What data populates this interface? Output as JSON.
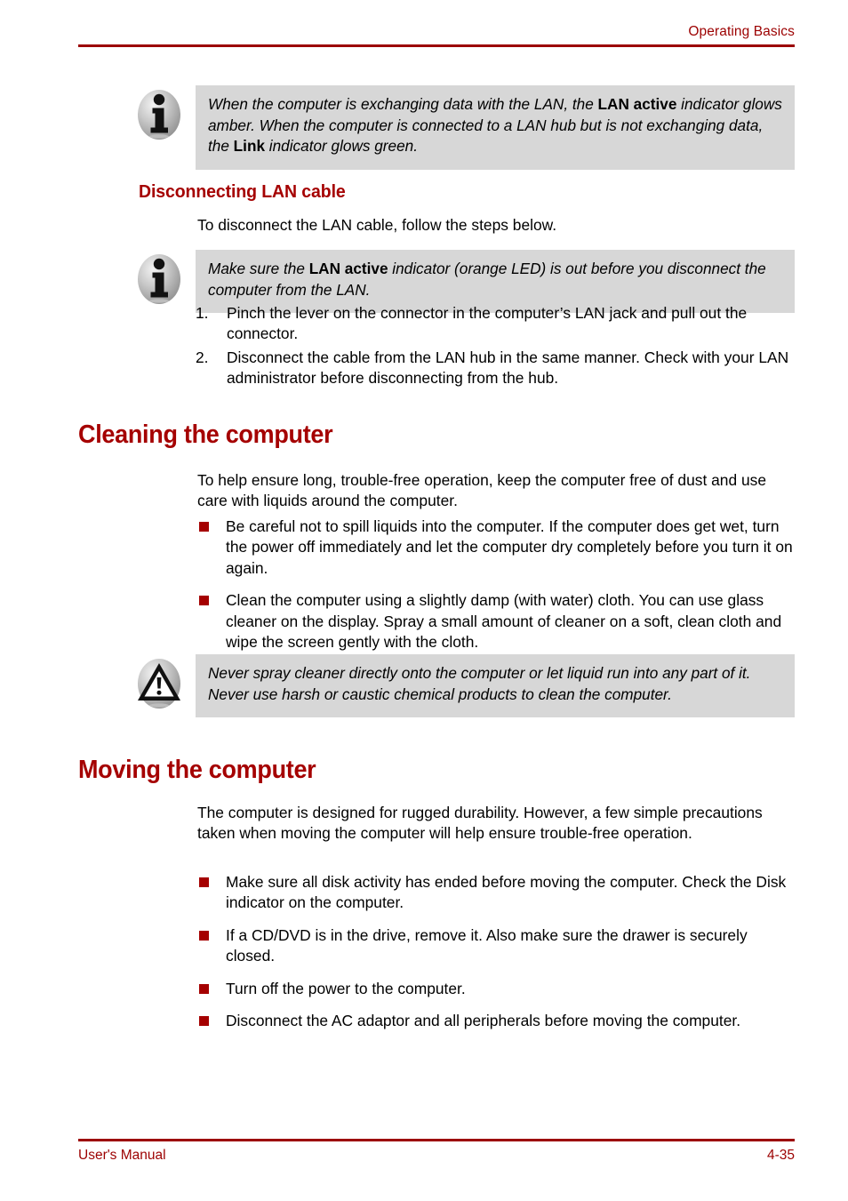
{
  "header": {
    "title": "Operating Basics",
    "rule_color": "#9c0000"
  },
  "footer": {
    "manual_label": "User's Manual",
    "page_number": "4-35",
    "rule_color": "#9c0000"
  },
  "theme": {
    "heading_red": "#a50000",
    "header_red": "#9c0000",
    "note_bg": "#d7d7d7",
    "bullet_red": "#a50000",
    "text_black": "#000000"
  },
  "notes": {
    "lan_active_note": {
      "icon": "info-icon",
      "parts": [
        {
          "text": "When the computer is exchanging data with the LAN, the ",
          "bold": false
        },
        {
          "text": "LAN active",
          "bold": true
        },
        {
          "text": " indicator glows amber. When the computer is connected to a LAN hub but is not exchanging data, the ",
          "bold": false
        },
        {
          "text": "Link",
          "bold": true
        },
        {
          "text": " indicator glows green.",
          "bold": false
        }
      ]
    },
    "lan_disconnect_note": {
      "icon": "info-icon",
      "parts": [
        {
          "text": "Make sure the ",
          "bold": false
        },
        {
          "text": "LAN active",
          "bold": true
        },
        {
          "text": " indicator (orange LED) is out before you disconnect the computer from the LAN.",
          "bold": false
        }
      ]
    },
    "cleaning_caution": {
      "icon": "caution-icon",
      "parts": [
        {
          "text": "Never spray cleaner directly onto the computer or let liquid run into any part of it. Never use harsh or caustic chemical products to clean the computer.",
          "bold": false
        }
      ]
    }
  },
  "sections": {
    "disconnecting_lan_cable": {
      "heading": "Disconnecting LAN cable",
      "intro": "To disconnect the LAN cable, follow the steps below.",
      "steps": [
        {
          "number": "1.",
          "text": "Pinch the lever on the connector in the computer’s LAN jack and pull out the connector."
        },
        {
          "number": "2.",
          "text": "Disconnect the cable from the LAN hub in the same manner. Check with your LAN administrator before disconnecting from the hub."
        }
      ]
    },
    "cleaning_the_computer": {
      "heading": "Cleaning the computer",
      "intro": "To help ensure long, trouble-free operation, keep the computer free of dust and use care with liquids around the computer.",
      "bullets": [
        "Be careful not to spill liquids into the computer. If the computer does get wet, turn the power off immediately and let the computer dry completely before you turn it on again.",
        "Clean the computer using a slightly damp (with water) cloth. You can use glass cleaner on the display. Spray a small amount of cleaner on a soft, clean cloth and wipe the screen gently with the cloth."
      ]
    },
    "moving_the_computer": {
      "heading": "Moving the computer",
      "intro": "The computer is designed for rugged durability. However, a few simple precautions taken when moving the computer will help ensure trouble-free operation.",
      "bullets": [
        "Make sure all disk activity has ended before moving the computer. Check the Disk indicator on the computer.",
        "If a CD/DVD is in the drive, remove it. Also make sure the drawer is securely closed.",
        "Turn off the power to the computer.",
        "Disconnect the AC adaptor and all peripherals before moving the computer."
      ]
    }
  }
}
